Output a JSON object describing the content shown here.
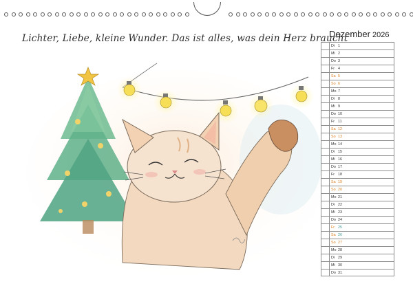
{
  "headline": "Lichter, Liebe, kleine Wunder. Das ist alles, was dein Herz braucht",
  "calendar": {
    "month": "Dezember",
    "year": "2026",
    "days": [
      {
        "dow": "Di",
        "day": "1",
        "type": "normal"
      },
      {
        "dow": "Mi",
        "day": "2",
        "type": "normal"
      },
      {
        "dow": "Do",
        "day": "3",
        "type": "normal"
      },
      {
        "dow": "Fr",
        "day": "4",
        "type": "normal"
      },
      {
        "dow": "Sa",
        "day": "5",
        "type": "weekend"
      },
      {
        "dow": "So",
        "day": "6",
        "type": "weekend"
      },
      {
        "dow": "Mo",
        "day": "7",
        "type": "normal"
      },
      {
        "dow": "Di",
        "day": "8",
        "type": "normal"
      },
      {
        "dow": "Mi",
        "day": "9",
        "type": "normal"
      },
      {
        "dow": "Do",
        "day": "10",
        "type": "normal"
      },
      {
        "dow": "Fr",
        "day": "11",
        "type": "normal"
      },
      {
        "dow": "Sa",
        "day": "12",
        "type": "weekend"
      },
      {
        "dow": "So",
        "day": "13",
        "type": "weekend"
      },
      {
        "dow": "Mo",
        "day": "14",
        "type": "normal"
      },
      {
        "dow": "Di",
        "day": "15",
        "type": "normal"
      },
      {
        "dow": "Mi",
        "day": "16",
        "type": "normal"
      },
      {
        "dow": "Do",
        "day": "17",
        "type": "normal"
      },
      {
        "dow": "Fr",
        "day": "18",
        "type": "normal"
      },
      {
        "dow": "Sa",
        "day": "19",
        "type": "weekend"
      },
      {
        "dow": "So",
        "day": "20",
        "type": "weekend"
      },
      {
        "dow": "Mo",
        "day": "21",
        "type": "normal"
      },
      {
        "dow": "Di",
        "day": "22",
        "type": "normal"
      },
      {
        "dow": "Mi",
        "day": "23",
        "type": "normal"
      },
      {
        "dow": "Do",
        "day": "24",
        "type": "normal"
      },
      {
        "dow": "Fr",
        "day": "25",
        "type": "holiday"
      },
      {
        "dow": "Sa",
        "day": "26",
        "type": "holiday"
      },
      {
        "dow": "So",
        "day": "27",
        "type": "weekend"
      },
      {
        "dow": "Mo",
        "day": "28",
        "type": "normal"
      },
      {
        "dow": "Di",
        "day": "29",
        "type": "normal"
      },
      {
        "dow": "Mi",
        "day": "30",
        "type": "normal"
      },
      {
        "dow": "Do",
        "day": "31",
        "type": "normal"
      }
    ]
  },
  "colors": {
    "weekend": "#d77f22",
    "holiday": "#3f9a9b",
    "grid": "#8d8d8d",
    "text": "#2b2b2b"
  },
  "artwork": {
    "subject": "smiling cat stretching toward fairy lights beside a christmas tree",
    "icons": [
      "christmas-tree-icon",
      "star-icon",
      "cat-illustration",
      "light-bulb-icon"
    ]
  }
}
